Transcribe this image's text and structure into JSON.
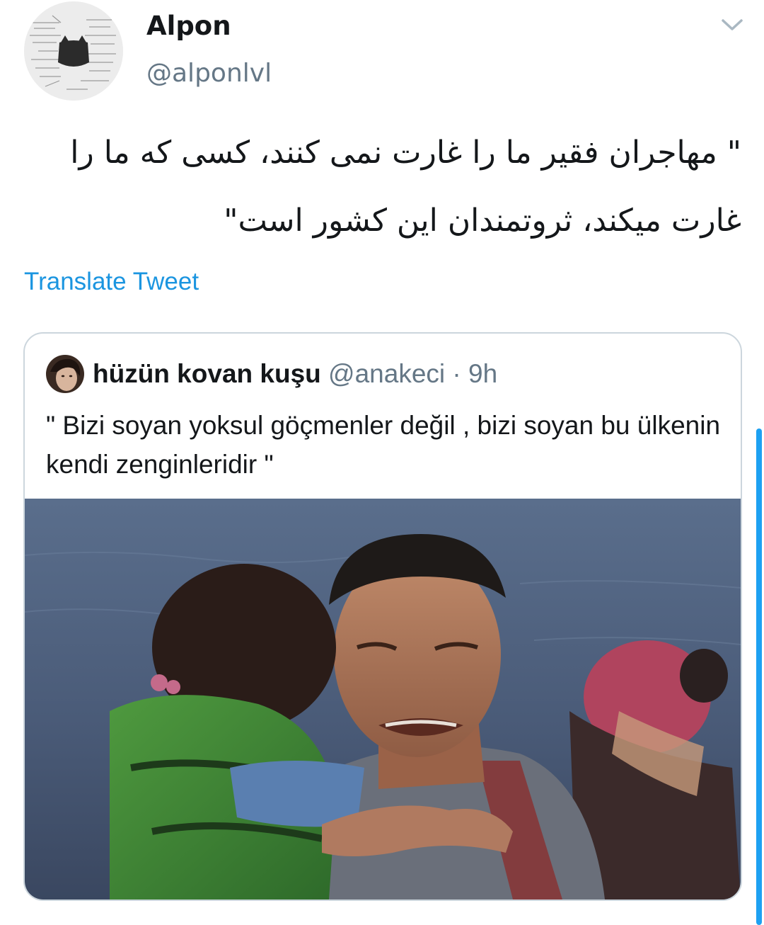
{
  "tweet": {
    "author": {
      "name": "Alpon",
      "handle": "@alponlvl",
      "avatar_icon": "notebook-cat-avatar"
    },
    "menu_icon": "chevron-down-icon",
    "text": "\" مهاجران فقیر ما را غارت نمی کنند، کسی که ما را غارت میکند، ثروتمندان این کشور است\"",
    "translate_label": "Translate Tweet"
  },
  "quote": {
    "author": {
      "name": "hüzün kovan kuşu",
      "handle": "@anakeci",
      "separator": "·",
      "time": "9h"
    },
    "text": "\" Bizi soyan yoksul göçmenler değil , bizi soyan bu ülkenin kendi zenginleridir \"",
    "media_kind": "photo"
  },
  "colors": {
    "link": "#1b95e0",
    "secondary_text": "#657786",
    "border": "#ccd6dd",
    "scrollbar": "#1da1f2"
  }
}
